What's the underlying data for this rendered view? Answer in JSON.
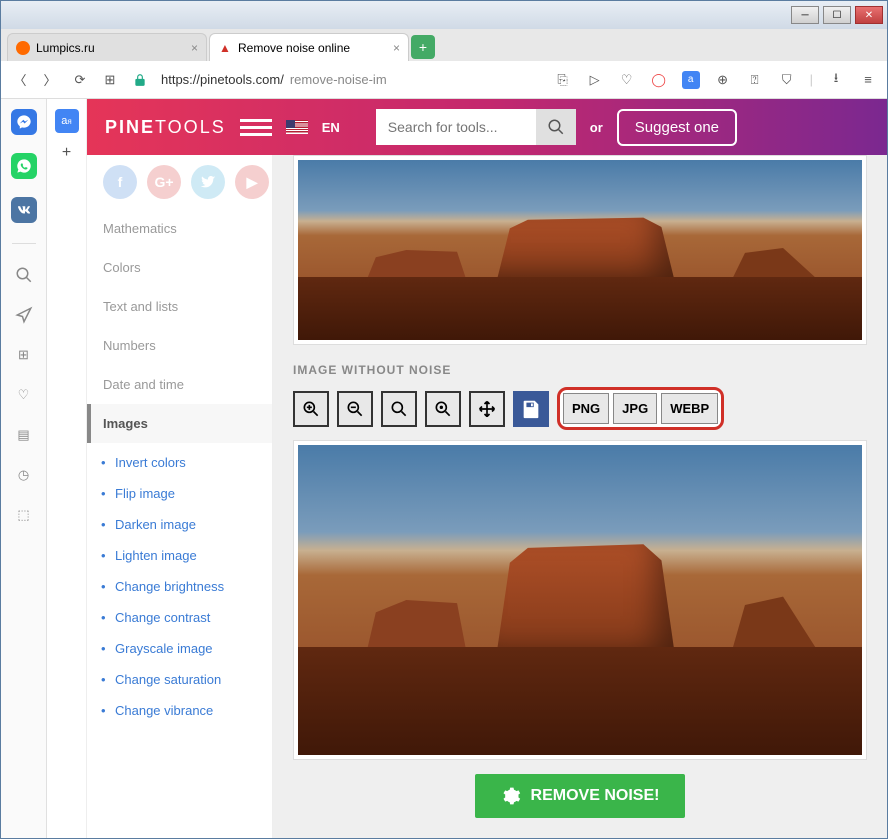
{
  "tabs": [
    {
      "title": "Lumpics.ru",
      "favicon_color": "#ff6a00"
    },
    {
      "title": "Remove noise online",
      "favicon_color": "#d03028"
    }
  ],
  "url": {
    "protocol_host": "https://pinetools.com/",
    "path": "remove-noise-im"
  },
  "header": {
    "logo_bold": "PINE",
    "logo_thin": "TOOLS",
    "lang": "EN",
    "search_placeholder": "Search for tools...",
    "or": "or",
    "suggest": "Suggest one"
  },
  "nav": {
    "items": [
      "Mathematics",
      "Colors",
      "Text and lists",
      "Numbers",
      "Date and time"
    ],
    "active": "Images",
    "sub": [
      "Invert colors",
      "Flip image",
      "Darken image",
      "Lighten image",
      "Change brightness",
      "Change contrast",
      "Grayscale image",
      "Change saturation",
      "Change vibrance"
    ]
  },
  "section_label": "IMAGE WITHOUT NOISE",
  "formats": [
    "PNG",
    "JPG",
    "WEBP"
  ],
  "remove_label": "REMOVE NOISE!",
  "opera": {
    "sidebar_icons": [
      "messenger",
      "whatsapp",
      "vk",
      "search",
      "send",
      "speed-dial",
      "heart",
      "news",
      "history",
      "extensions"
    ]
  }
}
